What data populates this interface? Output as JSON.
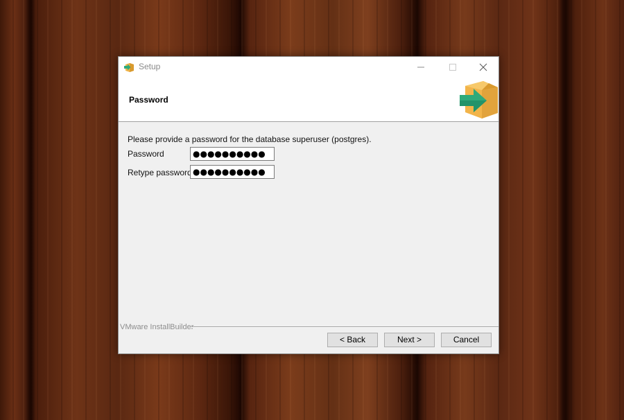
{
  "window": {
    "title": "Setup",
    "controls": {
      "minimize": "minimize",
      "maximize": "maximize",
      "close": "close"
    }
  },
  "header": {
    "title": "Password",
    "icon": "installer-box-arrow-icon"
  },
  "form": {
    "instruction": "Please provide a password for the database superuser (postgres).",
    "password_label": "Password",
    "password_value": "●●●●●●●●●●",
    "retype_label": "Retype password",
    "retype_value": "●●●●●●●●●●"
  },
  "footer": {
    "brand": "VMware InstallBuilder",
    "back_label": "< Back",
    "next_label": "Next >",
    "cancel_label": "Cancel"
  },
  "colors": {
    "icon_box": "#f2b44a",
    "icon_arrow": "#2faa7a",
    "window_bg": "#f0f0f0",
    "header_bg": "#ffffff"
  }
}
